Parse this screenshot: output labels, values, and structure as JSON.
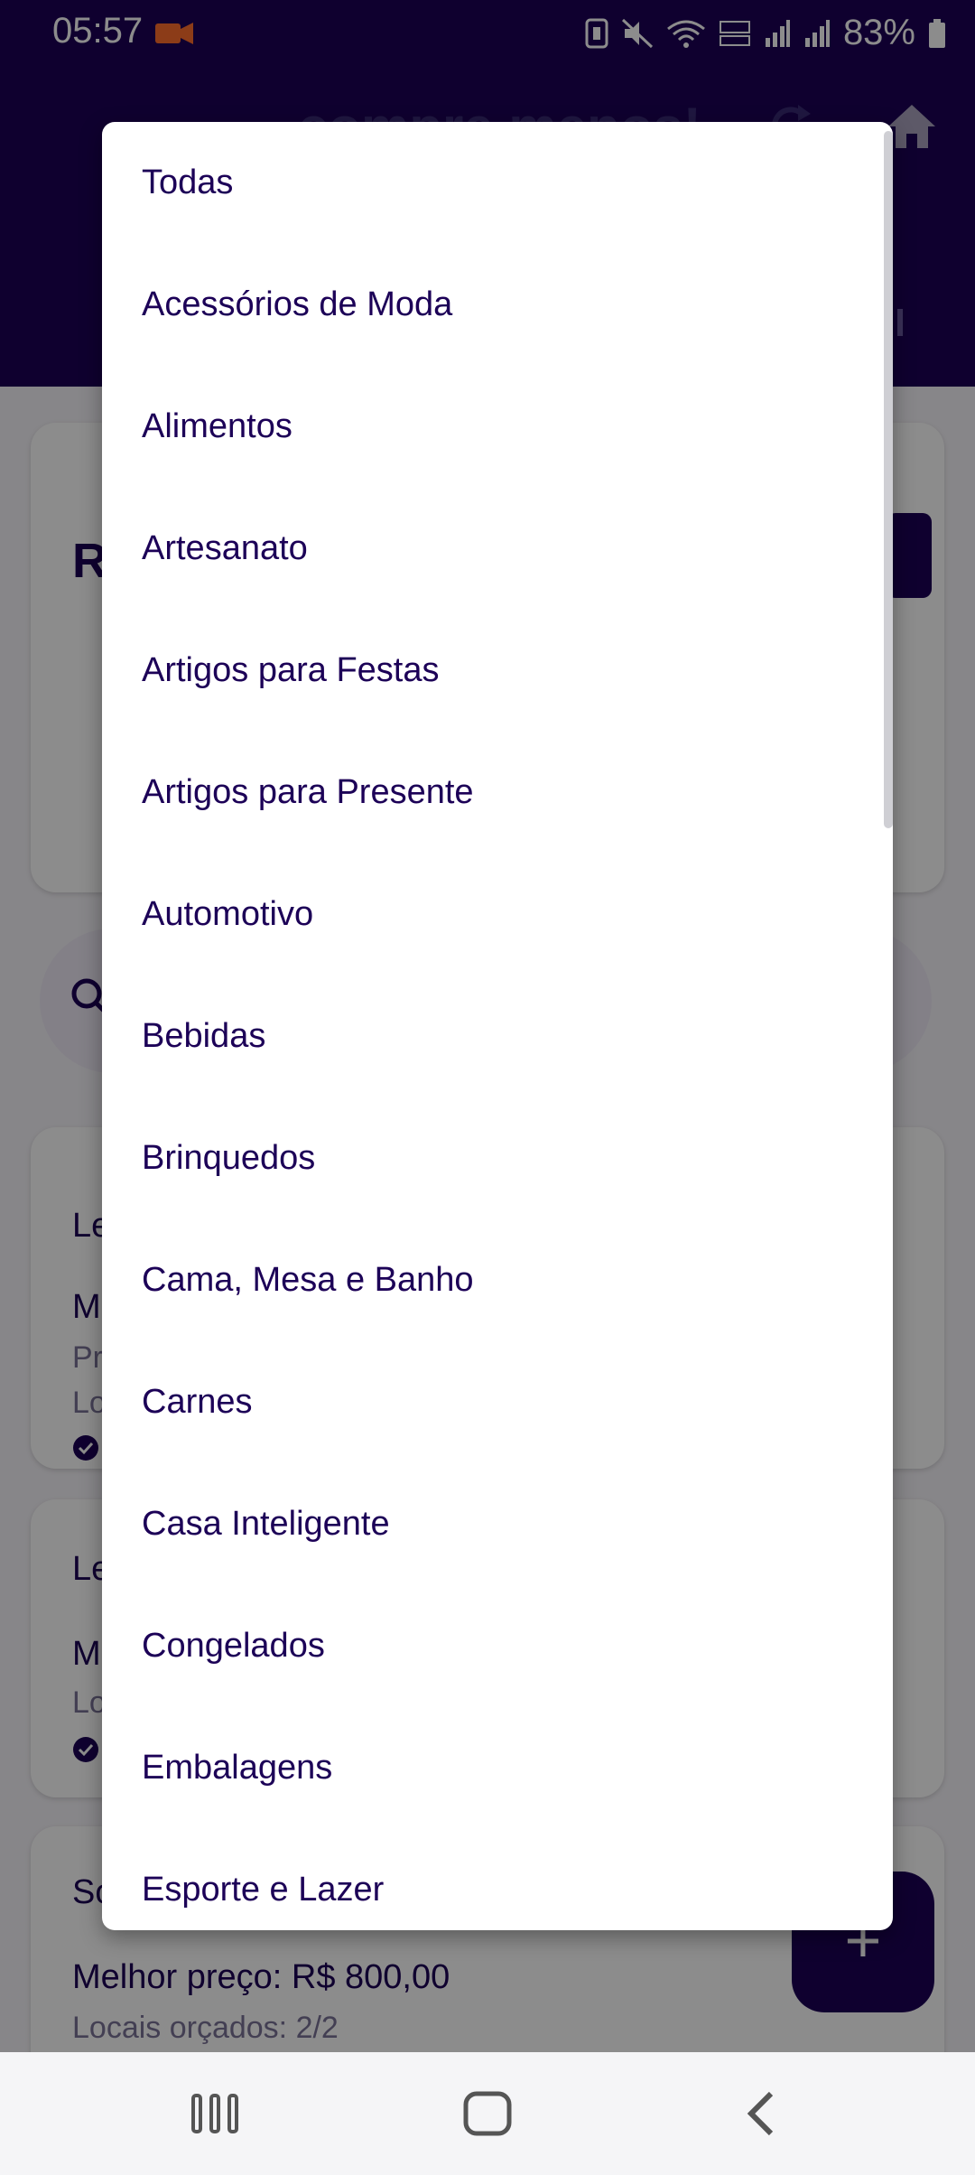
{
  "status_bar": {
    "time": "05:57",
    "battery": "83%"
  },
  "app_bar": {
    "title": "compre menos!"
  },
  "background": {
    "card1_initial": "R",
    "card2_initial": "Le",
    "card2_line1": "M",
    "card2_line2": "Pr",
    "card2_line3": "Lo",
    "card3_initial": "Le",
    "card3_line1": "M",
    "card3_line2": "Lo",
    "card4_initial": "So",
    "card4_price": "Melhor preço: R$ 800,00",
    "card4_locais": "Locais orçados: 2/2"
  },
  "menu": {
    "items": [
      "Todas",
      "Acessórios de Moda",
      "Alimentos",
      "Artesanato",
      "Artigos para Festas",
      "Artigos para Presente",
      "Automotivo",
      "Bebidas",
      "Brinquedos",
      "Cama, Mesa e Banho",
      "Carnes",
      "Casa Inteligente",
      "Congelados",
      "Embalagens",
      "Esporte e Lazer"
    ]
  },
  "colors": {
    "primary": "#1c0057",
    "menu_text": "#1c0057",
    "scrim": "rgba(0,0,0,0.45)"
  }
}
